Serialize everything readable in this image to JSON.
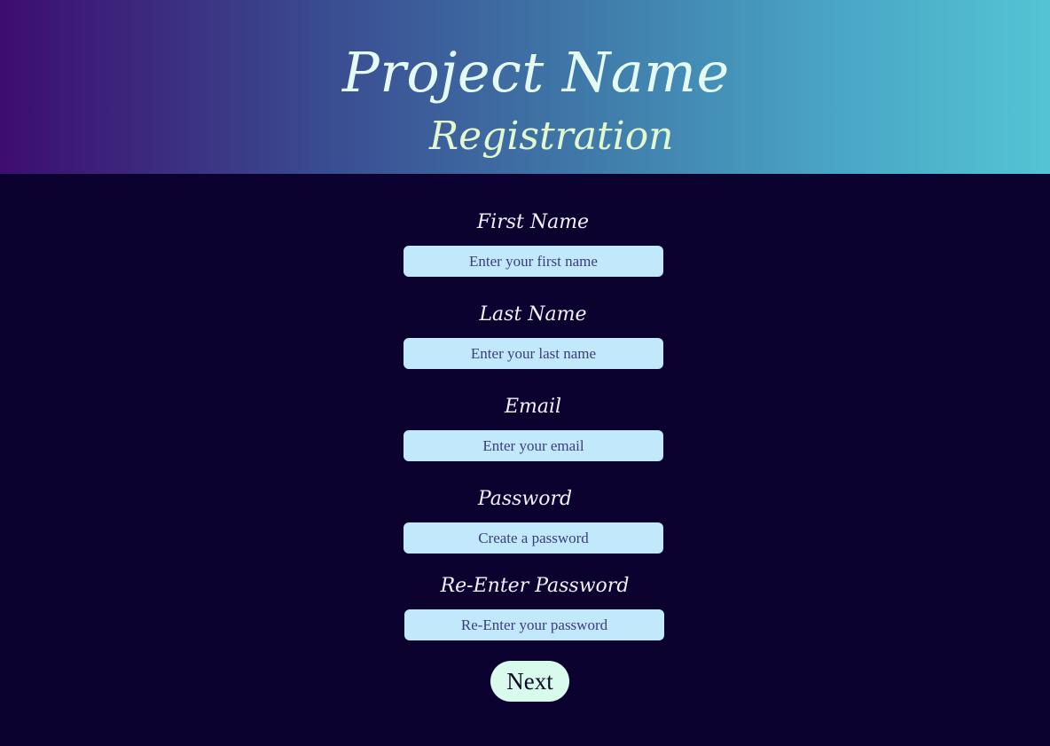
{
  "header": {
    "title": "Project Name",
    "subtitle": "Registration"
  },
  "form": {
    "first_name": {
      "label": "First Name",
      "placeholder": "Enter your first name"
    },
    "last_name": {
      "label": "Last Name",
      "placeholder": "Enter your last name"
    },
    "email": {
      "label": "Email",
      "placeholder": "Enter your email"
    },
    "password": {
      "label": "Password",
      "placeholder": "Create a password"
    },
    "confirm_password": {
      "label": "Re-Enter Password",
      "placeholder": "Re-Enter your password"
    },
    "next_label": "Next"
  },
  "colors": {
    "background": "#0b0230",
    "header_gradient_start": "#3d0d6f",
    "header_gradient_end": "#54c4d4",
    "input_background": "#c2e8fb",
    "input_text": "#3a3e7a",
    "button_background": "#d8fbee"
  }
}
